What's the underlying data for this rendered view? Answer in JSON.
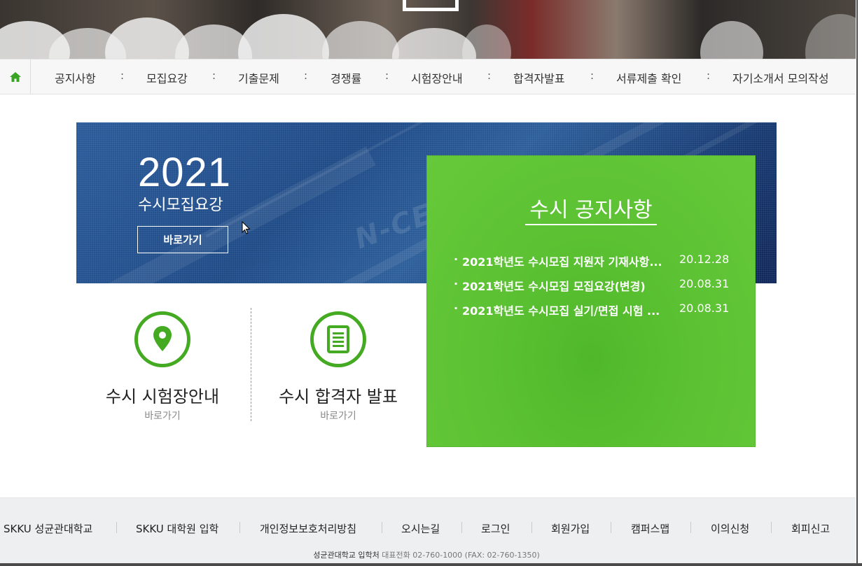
{
  "nav": {
    "items": [
      "공지사항",
      "모집요강",
      "기출문제",
      "경쟁률",
      "시험장안내",
      "합격자발표",
      "서류제출 확인",
      "자기소개서 모의작성"
    ],
    "separator": ":"
  },
  "banner": {
    "year": "2021",
    "subtitle": "수시모집요강",
    "button_label": "바로가기"
  },
  "notice": {
    "title": "수시 공지사항",
    "bullet": "·",
    "items": [
      {
        "title": "2021학년도 수시모집 지원자 기재사항...",
        "date": "20.12.28"
      },
      {
        "title": "2021학년도 수시모집 모집요강(변경)",
        "date": "20.08.31"
      },
      {
        "title": "2021학년도 수시모집 실기/면접 시험 ...",
        "date": "20.08.31"
      }
    ]
  },
  "quick_links": [
    {
      "title": "수시 시험장안내",
      "sub": "바로가기",
      "icon": "location-pin-icon"
    },
    {
      "title": "수시 합격자 발표",
      "sub": "바로가기",
      "icon": "document-icon"
    }
  ],
  "footer": {
    "links": [
      "SKKU 성균관대학교",
      "SKKU 대학원 입학",
      "개인정보보호처리방침",
      "오시는길",
      "로그인",
      "회원가입",
      "캠퍼스맵",
      "이의신청",
      "회피신고"
    ],
    "org": "성균관대학교 입학처",
    "phone_text": "대표전화 02-760-1000 (FAX: 02-760-1350)"
  },
  "colors": {
    "accent_green": "#44aa22",
    "notice_green": "#5cc233",
    "banner_blue": "#1e4a86"
  }
}
